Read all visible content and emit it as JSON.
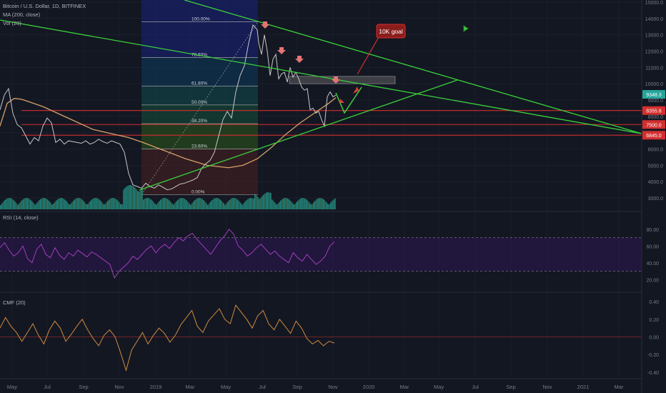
{
  "header": {
    "symbol_line": "Bitcoin / U.S. Dollar, 1D, BITFINEX",
    "ma_label": "MA (200, close)",
    "vol_label": "Vol (20)",
    "rsi_label": "RSI (14, close)",
    "cmf_label": "CMF (20)"
  },
  "colors": {
    "background": "#131722",
    "grid": "#1f2433",
    "price_line": "#c8c8c8",
    "ma": "#d8a06a",
    "trendline": "#3ad13a",
    "support_red": "#d32f2f",
    "rsi": "#a23fbf",
    "cmf": "#d08b3e",
    "volume": "#26a69a"
  },
  "chart_data": {
    "type": "line",
    "x_axis": {
      "ticks": [
        "May",
        "Jul",
        "Sep",
        "Nov",
        "2019",
        "Mar",
        "May",
        "Jul",
        "Sep",
        "Nov",
        "2020",
        "Mar",
        "May",
        "Jul",
        "Sep",
        "Nov",
        "2021",
        "Mar"
      ]
    },
    "price_axis": {
      "ticks": [
        "15000.0",
        "14000.0",
        "13000.0",
        "12000.0",
        "11000.0",
        "10000.0",
        "9000.0",
        "8000.0",
        "7000.0",
        "6000.0",
        "5000.0",
        "4000.0",
        "3000.0"
      ],
      "range": [
        2400,
        15100
      ]
    },
    "price_series": {
      "name": "BTCUSD",
      "x": [
        0,
        6,
        12,
        18,
        24,
        30,
        36,
        42,
        48,
        54,
        60,
        66,
        72,
        78,
        84,
        90,
        96,
        102,
        108,
        114,
        120,
        126,
        132,
        138,
        144,
        150,
        156,
        162,
        168,
        174,
        180,
        186,
        192,
        198,
        204,
        210,
        216,
        222,
        228,
        234,
        240,
        246,
        252,
        258,
        264,
        270,
        276,
        282,
        288,
        294,
        300,
        306,
        312,
        318,
        324,
        330,
        336,
        342,
        348,
        354,
        360,
        362,
        366,
        370,
        374,
        378,
        382,
        386,
        390,
        394,
        398,
        402,
        406,
        410,
        414,
        418,
        422,
        426,
        430,
        434,
        438,
        442,
        446,
        450,
        454,
        458,
        462,
        466,
        470
      ],
      "values": [
        8400,
        9300,
        9700,
        8200,
        7500,
        7300,
        6800,
        6300,
        6700,
        6500,
        7400,
        7900,
        7600,
        6400,
        6600,
        6300,
        6500,
        6450,
        6400,
        6350,
        6500,
        6300,
        6400,
        6600,
        6450,
        6350,
        6500,
        6400,
        6300,
        5800,
        4500,
        3800,
        3700,
        3600,
        3900,
        3700,
        3600,
        3800,
        3650,
        3500,
        3550,
        3700,
        3850,
        3900,
        4000,
        4100,
        4250,
        4800,
        5100,
        5300,
        5800,
        6800,
        7800,
        8300,
        7900,
        9500,
        10500,
        11100,
        12500,
        13600,
        13300,
        12500,
        11800,
        13000,
        12000,
        10500,
        11500,
        11800,
        10300,
        10600,
        10700,
        10100,
        11000,
        10400,
        10700,
        10300,
        9800,
        9600,
        9700,
        8400,
        8500,
        8200,
        8300,
        7800,
        7400,
        9200,
        9500,
        9200,
        9300
      ]
    },
    "ma_series": {
      "name": "MA (200, close)",
      "x": [
        0,
        10,
        20,
        30,
        40,
        60,
        80,
        100,
        130,
        160,
        180,
        200,
        230,
        260,
        290,
        320,
        340,
        360,
        380,
        400,
        420,
        440,
        460,
        470
      ],
      "values": [
        7400,
        8800,
        9100,
        9050,
        8900,
        8600,
        8200,
        7800,
        7200,
        6900,
        6700,
        6400,
        5900,
        5400,
        5000,
        4850,
        5000,
        5400,
        6100,
        6900,
        7600,
        8200,
        8800,
        9150
      ]
    },
    "fibonacci": {
      "levels": [
        {
          "label": "100.00%",
          "value": 13800
        },
        {
          "label": "78.60%",
          "value": 11600
        },
        {
          "label": "61.80%",
          "value": 9850
        },
        {
          "label": "50.00%",
          "value": 8700
        },
        {
          "label": "38.20%",
          "value": 7550
        },
        {
          "label": "23.60%",
          "value": 6000
        },
        {
          "label": "0.00%",
          "value": 3200
        }
      ]
    },
    "horizontal_levels": [
      {
        "label": "8355.8",
        "value": 8355.8
      },
      {
        "label": "7500.0",
        "value": 7500
      },
      {
        "label": "6845.0",
        "value": 6845
      }
    ],
    "last_price_label": "9348.3",
    "annotation": "10K goal",
    "rsi": {
      "label": "RSI (14, close)",
      "ticks": [
        "80.00",
        "60.00",
        "40.00",
        "20.00"
      ],
      "range": [
        10,
        90
      ],
      "band": [
        30,
        70
      ],
      "values": [
        58,
        64,
        55,
        48,
        52,
        60,
        45,
        40,
        56,
        62,
        50,
        46,
        58,
        49,
        44,
        52,
        48,
        55,
        51,
        47,
        53,
        50,
        46,
        42,
        38,
        22,
        30,
        35,
        40,
        48,
        44,
        50,
        56,
        60,
        52,
        58,
        62,
        57,
        64,
        70,
        66,
        72,
        75,
        68,
        62,
        56,
        50,
        58,
        66,
        72,
        80,
        74,
        60,
        55,
        48,
        52,
        58,
        62,
        56,
        50,
        54,
        48,
        44,
        40,
        52,
        46,
        42,
        50,
        44,
        38,
        42,
        48,
        60,
        65
      ]
    },
    "cmf": {
      "label": "CMF (20)",
      "ticks": [
        "0.40",
        "0.20",
        "0.00",
        "-0.20",
        "-0.40"
      ],
      "range": [
        -0.45,
        0.45
      ],
      "values": [
        0.1,
        0.22,
        0.12,
        0.05,
        -0.05,
        0.05,
        0.15,
        0.02,
        -0.08,
        0.08,
        0.18,
        0.1,
        -0.05,
        0.03,
        0.12,
        0.2,
        0.08,
        -0.02,
        -0.1,
        0.02,
        0.08,
        0.0,
        -0.18,
        -0.38,
        -0.15,
        -0.05,
        0.05,
        -0.08,
        0.02,
        0.1,
        0.04,
        -0.06,
        0.02,
        0.14,
        0.22,
        0.3,
        0.12,
        0.05,
        0.18,
        0.25,
        0.32,
        0.2,
        0.15,
        0.36,
        0.28,
        0.2,
        0.1,
        0.24,
        0.3,
        0.15,
        0.08,
        0.2,
        0.12,
        0.04,
        0.18,
        0.1,
        -0.02,
        -0.08,
        -0.04,
        -0.1,
        -0.05,
        -0.07
      ]
    }
  }
}
